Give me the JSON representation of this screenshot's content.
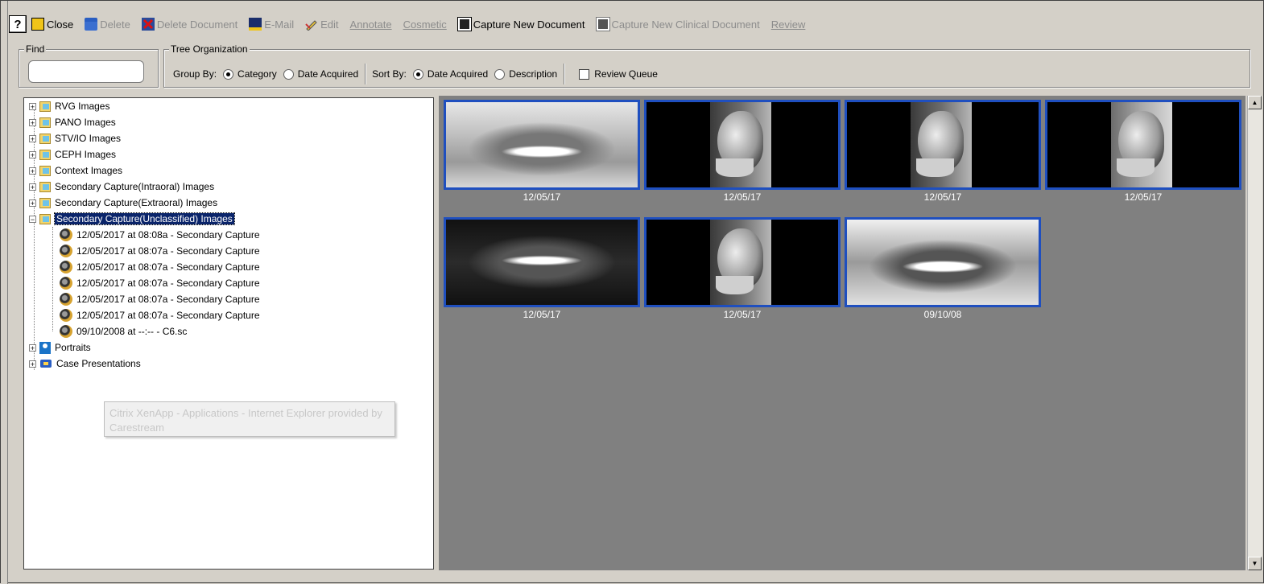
{
  "toolbar": {
    "help": "?",
    "close": "Close",
    "delete": "Delete",
    "delete_document": "Delete Document",
    "email": "E-Mail",
    "edit": "Edit",
    "annotate": "Annotate",
    "cosmetic": "Cosmetic",
    "capture_new_document": "Capture New Document",
    "capture_new_clinical_document": "Capture New Clinical Document",
    "review": "Review"
  },
  "find": {
    "legend": "Find",
    "value": ""
  },
  "tree_org": {
    "legend": "Tree Organization",
    "group_by_label": "Group By:",
    "group_by_options": [
      "Category",
      "Date Acquired"
    ],
    "group_by_selected": "Category",
    "sort_by_label": "Sort By:",
    "sort_by_options": [
      "Date Acquired",
      "Description"
    ],
    "sort_by_selected": "Date Acquired",
    "review_queue_label": "Review Queue",
    "review_queue_checked": false
  },
  "tree": {
    "categories": [
      "RVG Images",
      "PANO Images",
      "STV/IO Images",
      "CEPH Images",
      "Context Images",
      "Secondary Capture(Intraoral) Images",
      "Secondary Capture(Extraoral) Images",
      "Secondary Capture(Unclassified) Images"
    ],
    "selected": "Secondary Capture(Unclassified) Images",
    "children": [
      "12/05/2017 at 08:08a - Secondary Capture",
      "12/05/2017 at 08:07a - Secondary Capture",
      "12/05/2017 at 08:07a - Secondary Capture",
      "12/05/2017 at 08:07a - Secondary Capture",
      "12/05/2017 at 08:07a - Secondary Capture",
      "12/05/2017 at 08:07a - Secondary Capture",
      "09/10/2008 at --:-- - C6.sc"
    ],
    "portraits": "Portraits",
    "case_presentations": "Case Presentations"
  },
  "tooltip": "Citrix XenApp - Applications - Internet Explorer provided by Carestream",
  "gallery": {
    "thumbnails": [
      {
        "type": "pano",
        "date": "12/05/17"
      },
      {
        "type": "ceph",
        "date": "12/05/17"
      },
      {
        "type": "ceph",
        "date": "12/05/17"
      },
      {
        "type": "ceph",
        "date": "12/05/17"
      },
      {
        "type": "pano-dark",
        "date": "12/05/17"
      },
      {
        "type": "ceph",
        "date": "12/05/17"
      },
      {
        "type": "pano",
        "date": "09/10/08"
      }
    ]
  },
  "colors": {
    "window_bg": "#d4d0c8",
    "gallery_bg": "#808080",
    "thumb_border": "#1f4fbf",
    "selection": "#0a246a"
  }
}
